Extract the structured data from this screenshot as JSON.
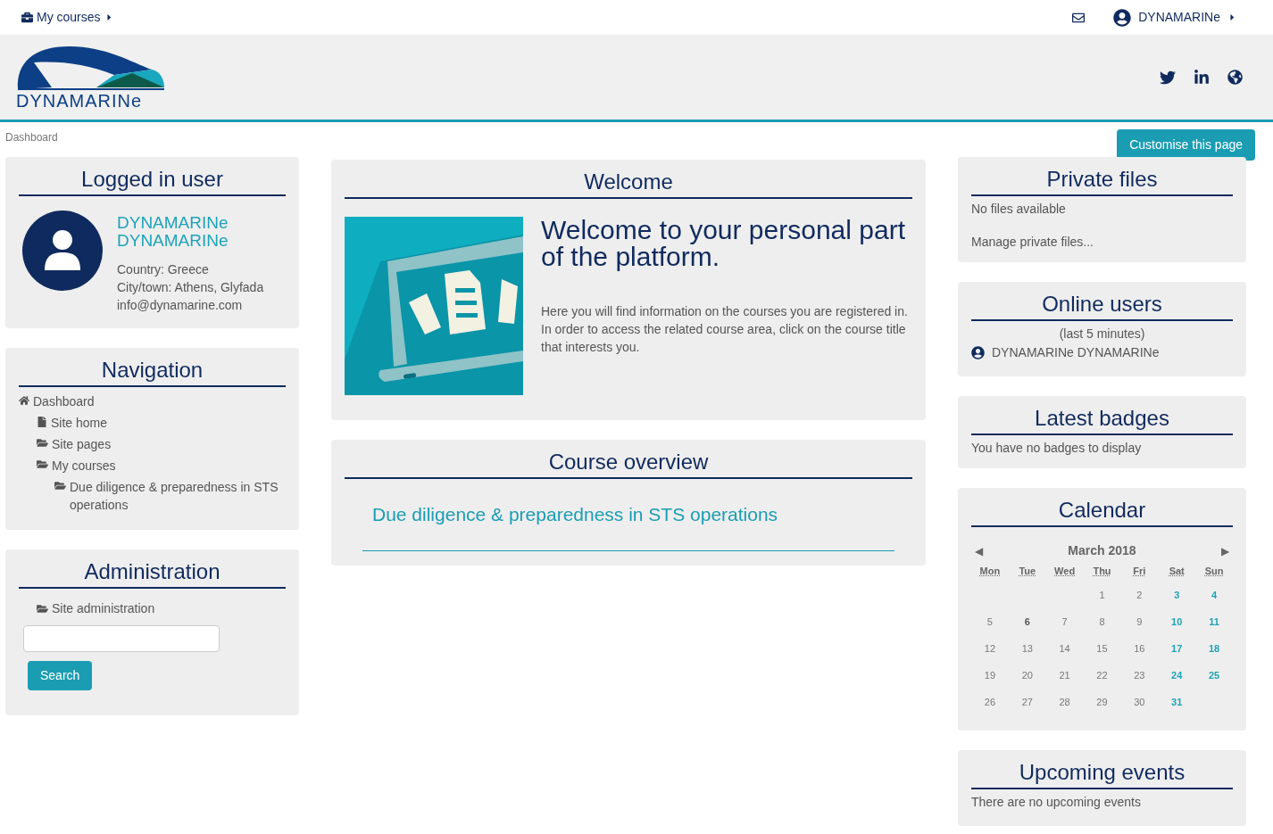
{
  "top_bar": {
    "courses_menu": "My courses",
    "user_menu": "DYNAMARINe"
  },
  "header": {
    "logo_text": "DYNAMARINe"
  },
  "breadcrumb": "Dashboard",
  "customise_button": "Customise this page",
  "logged_in_user": {
    "title": "Logged in user",
    "name": "DYNAMARINe DYNAMARINe",
    "details": [
      "Country: Greece",
      "City/town: Athens, Glyfada",
      "info@dynamarine.com"
    ]
  },
  "navigation": {
    "title": "Navigation",
    "items": [
      {
        "label": "Dashboard",
        "kind": "home",
        "children": [
          {
            "label": "Site home",
            "kind": "page"
          },
          {
            "label": "Site pages",
            "kind": "folder"
          },
          {
            "label": "My courses",
            "kind": "folder",
            "children": [
              {
                "label": "Due diligence & preparedness in STS operations",
                "kind": "folder"
              }
            ]
          }
        ]
      }
    ]
  },
  "administration": {
    "title": "Administration",
    "item": "Site administration",
    "search_button": "Search"
  },
  "welcome": {
    "title": "Welcome",
    "heading": "Welcome to your personal part of the platform.",
    "paragraphs": [
      "Here you will find information on the courses you are registered in.",
      "In order to access the related course area, click on the course title that interests you."
    ]
  },
  "course_overview": {
    "title": "Course overview",
    "courses": [
      "Due diligence & preparedness in STS operations"
    ]
  },
  "private_files": {
    "title": "Private files",
    "empty": "No files available",
    "manage_link": "Manage private files..."
  },
  "online_users": {
    "title": "Online users",
    "period": "(last 5 minutes)",
    "users": [
      "DYNAMARINe DYNAMARINe"
    ]
  },
  "latest_badges": {
    "title": "Latest badges",
    "empty": "You have no badges to display"
  },
  "calendar": {
    "title": "Calendar",
    "prev": "◀",
    "next": "▶",
    "month": "March 2018",
    "weekdays": [
      "Mon",
      "Tue",
      "Wed",
      "Thu",
      "Fri",
      "Sat",
      "Sun"
    ],
    "weeks": [
      {
        "kind": "trailing",
        "days": [
          {
            "day": "1",
            "kind": "weekday"
          },
          {
            "day": "2",
            "kind": "weekday"
          },
          {
            "day": "3",
            "kind": "weekend"
          },
          {
            "day": "4",
            "kind": "weekend"
          }
        ]
      },
      {
        "kind": "leading",
        "days": [
          {
            "day": "5",
            "kind": "weekday"
          },
          {
            "day": "6",
            "kind": "today"
          },
          {
            "day": "7",
            "kind": "weekday"
          },
          {
            "day": "8",
            "kind": "weekday"
          },
          {
            "day": "9",
            "kind": "weekday"
          },
          {
            "day": "10",
            "kind": "weekend"
          },
          {
            "day": "11",
            "kind": "weekend"
          }
        ]
      },
      {
        "kind": "leading",
        "days": [
          {
            "day": "12",
            "kind": "weekday"
          },
          {
            "day": "13",
            "kind": "weekday"
          },
          {
            "day": "14",
            "kind": "weekday"
          },
          {
            "day": "15",
            "kind": "weekday"
          },
          {
            "day": "16",
            "kind": "weekday"
          },
          {
            "day": "17",
            "kind": "weekend"
          },
          {
            "day": "18",
            "kind": "weekend"
          }
        ]
      },
      {
        "kind": "leading",
        "days": [
          {
            "day": "19",
            "kind": "weekday"
          },
          {
            "day": "20",
            "kind": "weekday"
          },
          {
            "day": "21",
            "kind": "weekday"
          },
          {
            "day": "22",
            "kind": "weekday"
          },
          {
            "day": "23",
            "kind": "weekday"
          },
          {
            "day": "24",
            "kind": "weekend"
          },
          {
            "day": "25",
            "kind": "weekend"
          }
        ]
      },
      {
        "kind": "leading",
        "days": [
          {
            "day": "26",
            "kind": "weekday"
          },
          {
            "day": "27",
            "kind": "weekday"
          },
          {
            "day": "28",
            "kind": "weekday"
          },
          {
            "day": "29",
            "kind": "weekday"
          },
          {
            "day": "30",
            "kind": "weekday"
          },
          {
            "day": "31",
            "kind": "weekend"
          }
        ]
      }
    ]
  },
  "upcoming_events": {
    "title": "Upcoming events",
    "empty": "There are no upcoming events"
  }
}
